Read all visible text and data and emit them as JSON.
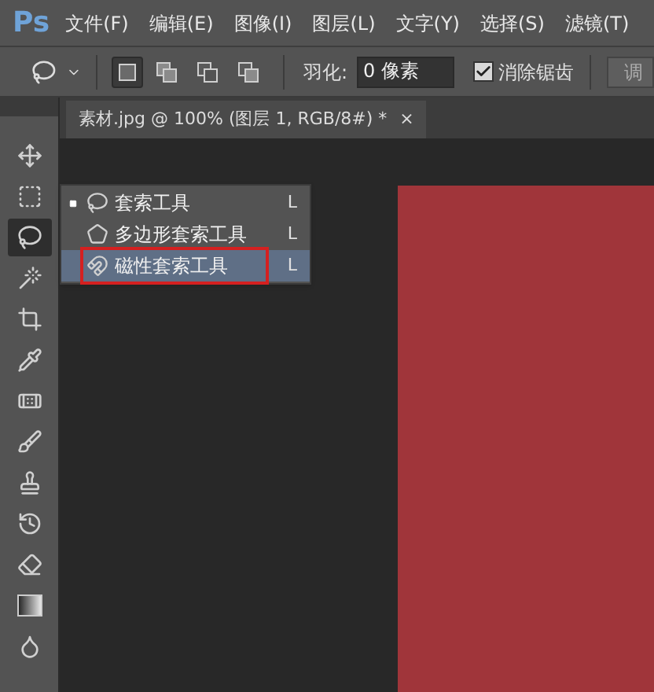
{
  "app": {
    "logo": "Ps"
  },
  "menu_bar": [
    "文件(F)",
    "编辑(E)",
    "图像(I)",
    "图层(L)",
    "文字(Y)",
    "选择(S)",
    "滤镜(T)"
  ],
  "options_bar": {
    "modes": [
      {
        "selected": true
      },
      {
        "selected": false
      },
      {
        "selected": false
      },
      {
        "selected": false
      }
    ],
    "feather_label": "羽化:",
    "feather_value": "0 像素",
    "antialias": {
      "label": "消除锯齿",
      "checked": true
    },
    "refine_button": "调"
  },
  "document_tab": {
    "title": "素材.jpg @ 100% (图层 1, RGB/8#) *",
    "close": "×"
  },
  "tools": [
    {
      "selected": false
    },
    {
      "selected": false
    },
    {
      "selected": true
    },
    {
      "selected": false
    },
    {
      "selected": false
    },
    {
      "selected": false
    },
    {
      "selected": false
    },
    {
      "selected": false
    },
    {
      "selected": false
    },
    {
      "selected": false
    },
    {
      "selected": false
    },
    {
      "selected": false
    },
    {
      "selected": false
    }
  ],
  "tool_flyout": [
    {
      "label": "套索工具",
      "shortcut": "L",
      "current": true,
      "selected": false,
      "annotated": false
    },
    {
      "label": "多边形套索工具",
      "shortcut": "L",
      "current": false,
      "selected": false,
      "annotated": false
    },
    {
      "label": "磁性套索工具",
      "shortcut": "L",
      "current": false,
      "selected": true,
      "annotated": true
    }
  ]
}
